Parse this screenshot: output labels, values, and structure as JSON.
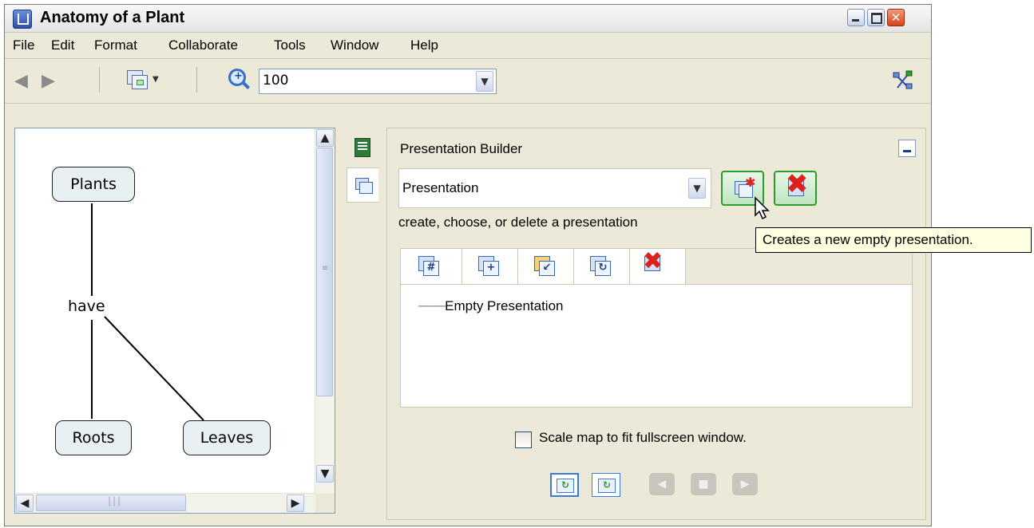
{
  "window": {
    "title": "Anatomy of a Plant",
    "close_glyph": "✕"
  },
  "menu": [
    "File",
    "Edit",
    "Format",
    "Collaborate",
    "Tools",
    "Window",
    "Help"
  ],
  "toolbar": {
    "zoom_value": "100"
  },
  "map": {
    "nodes": {
      "plants": "Plants",
      "roots": "Roots",
      "leaves": "Leaves"
    },
    "link_label": "have"
  },
  "builder": {
    "title": "Presentation Builder",
    "selected_presentation": "Presentation",
    "hint": "create, choose, or delete a presentation",
    "slides": [
      "Empty Presentation"
    ],
    "scale_label": "Scale map to fit fullscreen window.",
    "scale_checked": false
  },
  "tooltip": "Creates a new empty presentation.",
  "colors": {
    "node_fill": "#e8f0f4",
    "accent_green": "#2e9b2e",
    "delete_red": "#e0201c",
    "tooltip_bg": "#ffffe1"
  }
}
